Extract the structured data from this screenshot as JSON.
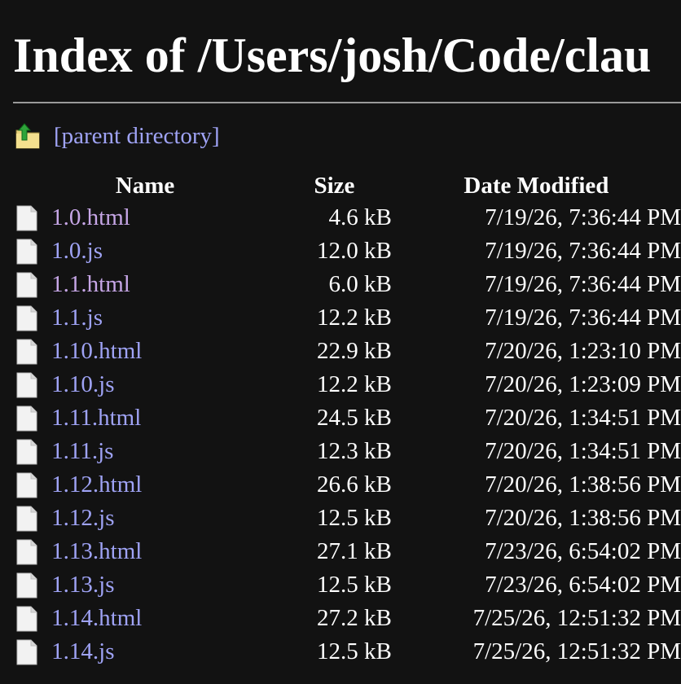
{
  "title": "Index of /Users/josh/Code/clau",
  "parent": {
    "label": "[parent directory]",
    "icon": "folder-up-icon"
  },
  "table": {
    "headers": {
      "name": "Name",
      "size": "Size",
      "date": "Date Modified"
    },
    "rows": [
      {
        "name": "1.0.html",
        "size": "4.6 kB",
        "date": "7/19/26, 7:36:44 PM",
        "visited": true
      },
      {
        "name": "1.0.js",
        "size": "12.0 kB",
        "date": "7/19/26, 7:36:44 PM",
        "visited": false
      },
      {
        "name": "1.1.html",
        "size": "6.0 kB",
        "date": "7/19/26, 7:36:44 PM",
        "visited": true
      },
      {
        "name": "1.1.js",
        "size": "12.2 kB",
        "date": "7/19/26, 7:36:44 PM",
        "visited": false
      },
      {
        "name": "1.10.html",
        "size": "22.9 kB",
        "date": "7/20/26, 1:23:10 PM",
        "visited": false
      },
      {
        "name": "1.10.js",
        "size": "12.2 kB",
        "date": "7/20/26, 1:23:09 PM",
        "visited": false
      },
      {
        "name": "1.11.html",
        "size": "24.5 kB",
        "date": "7/20/26, 1:34:51 PM",
        "visited": false
      },
      {
        "name": "1.11.js",
        "size": "12.3 kB",
        "date": "7/20/26, 1:34:51 PM",
        "visited": false
      },
      {
        "name": "1.12.html",
        "size": "26.6 kB",
        "date": "7/20/26, 1:38:56 PM",
        "visited": false
      },
      {
        "name": "1.12.js",
        "size": "12.5 kB",
        "date": "7/20/26, 1:38:56 PM",
        "visited": false
      },
      {
        "name": "1.13.html",
        "size": "27.1 kB",
        "date": "7/23/26, 6:54:02 PM",
        "visited": false
      },
      {
        "name": "1.13.js",
        "size": "12.5 kB",
        "date": "7/23/26, 6:54:02 PM",
        "visited": false
      },
      {
        "name": "1.14.html",
        "size": "27.2 kB",
        "date": "7/25/26, 12:51:32 PM",
        "visited": false
      },
      {
        "name": "1.14.js",
        "size": "12.5 kB",
        "date": "7/25/26, 12:51:32 PM",
        "visited": false
      }
    ]
  },
  "colors": {
    "background": "#121212",
    "link": "#9fa3f5",
    "visited_link": "#c6a6e6",
    "text": "#ffffff"
  }
}
